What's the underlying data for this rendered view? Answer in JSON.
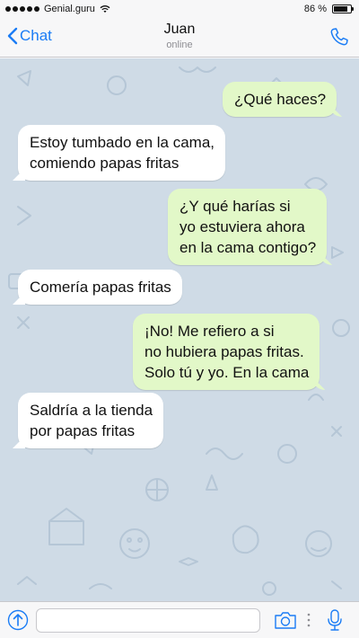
{
  "status_bar": {
    "carrier": "Genial.guru",
    "battery_text": "86 %",
    "battery_level": 0.86
  },
  "header": {
    "back_label": "Chat",
    "contact_name": "Juan",
    "contact_status": "online"
  },
  "messages": [
    {
      "side": "out",
      "text": "¿Qué haces?"
    },
    {
      "side": "in",
      "text": "Estoy tumbado en la cama,\ncomiendo papas fritas"
    },
    {
      "side": "out",
      "text": "¿Y qué harías si\nyo estuviera ahora\nen la cama contigo?"
    },
    {
      "side": "in",
      "text": "Comería papas fritas"
    },
    {
      "side": "out",
      "text": "¡No! Me refiero a si\nno hubiera papas fritas.\nSolo tú y yo. En la cama"
    },
    {
      "side": "in",
      "text": "Saldría a la tienda\npor papas fritas"
    }
  ],
  "input": {
    "value": "",
    "placeholder": ""
  },
  "colors": {
    "accent": "#1a7cf5",
    "outgoing_bubble": "#e2f8c8",
    "incoming_bubble": "#ffffff",
    "chat_background": "#cfdbe6"
  },
  "icons": {
    "back": "chevron-left-icon",
    "call": "phone-icon",
    "attach": "upload-arrow-icon",
    "camera": "camera-icon",
    "more": "vertical-dots-icon",
    "mic": "microphone-icon"
  }
}
